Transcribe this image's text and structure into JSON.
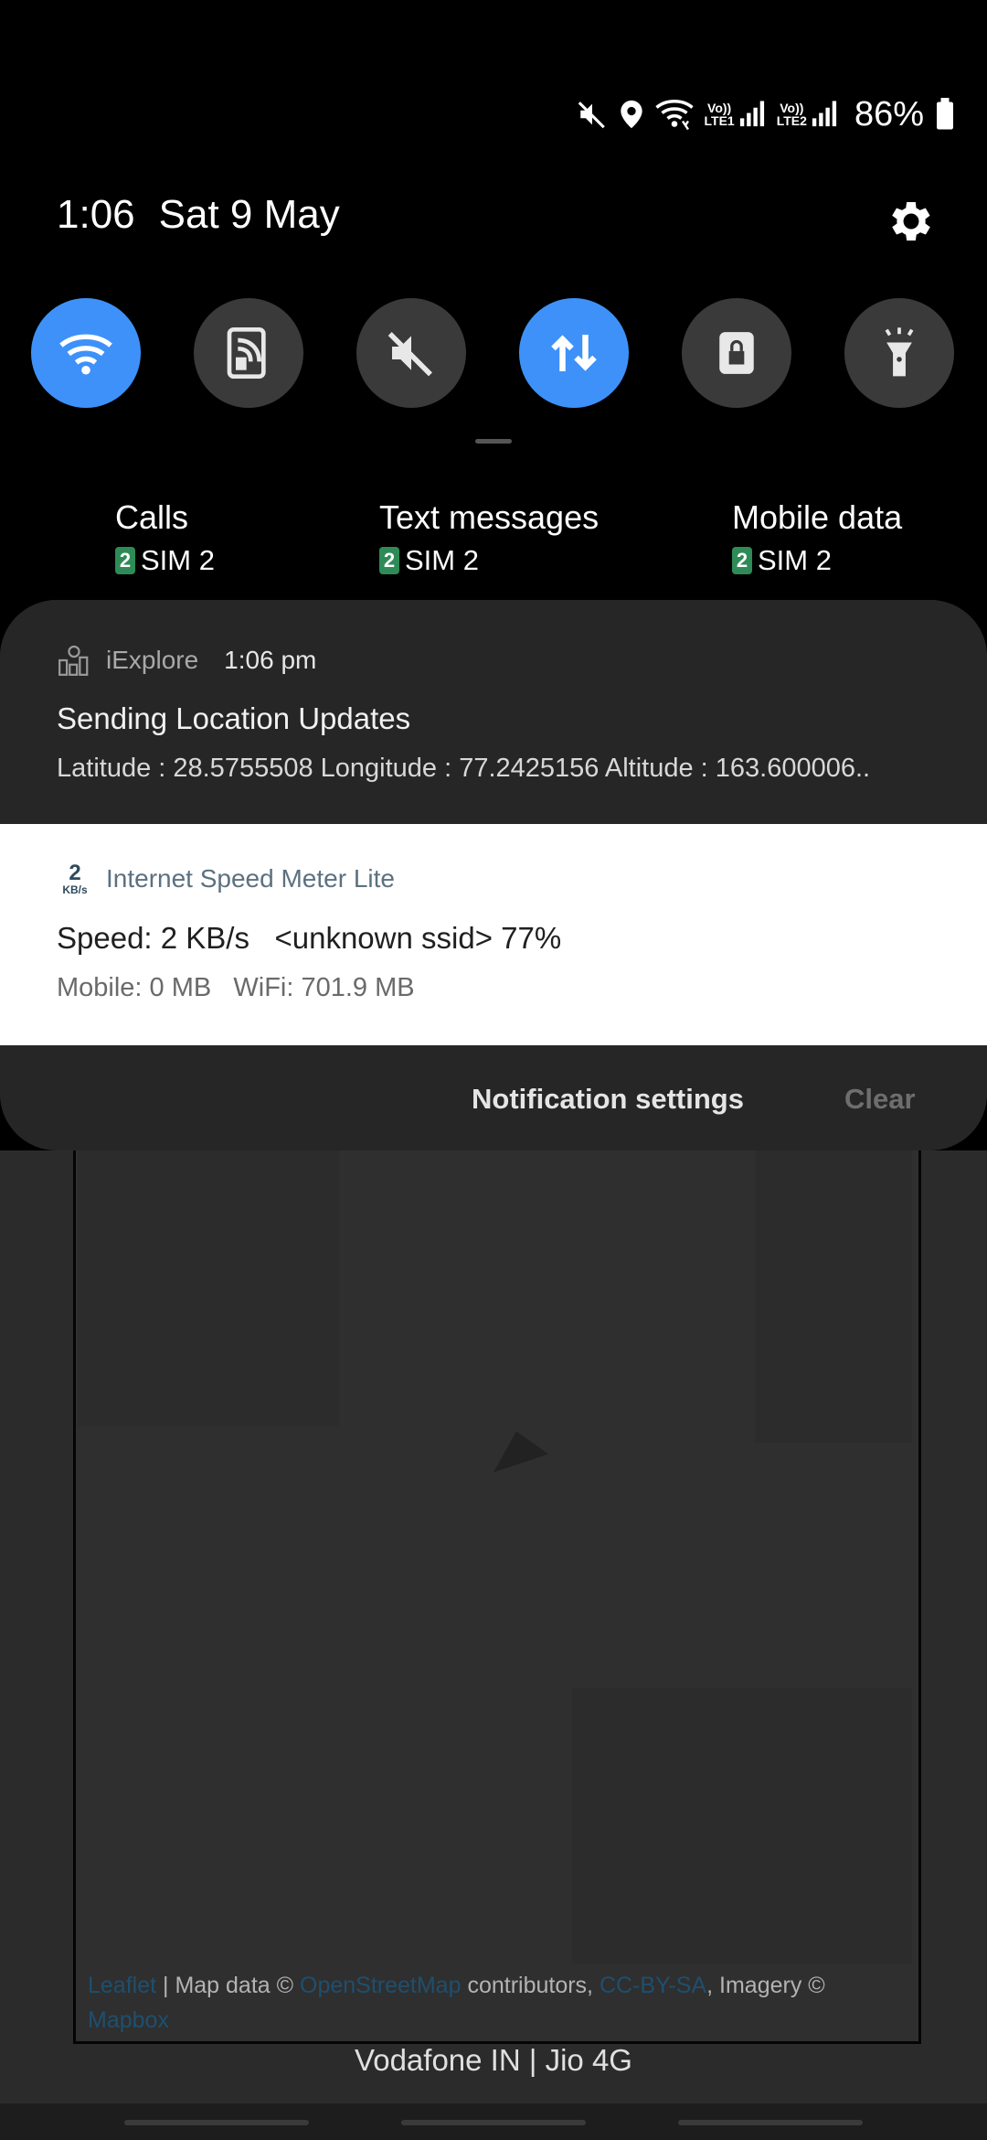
{
  "status_bar": {
    "icons": [
      "mute-icon",
      "location-icon",
      "wifi-icon",
      "volte-sim1-signal-icon",
      "volte-sim2-signal-icon",
      "battery-icon"
    ],
    "lte1_label": "LTE1",
    "lte2_label": "LTE2",
    "vo_label": "Vo))",
    "battery": "86%"
  },
  "header": {
    "time": "1:06",
    "date": "Sat 9 May"
  },
  "quick_toggles": [
    {
      "name": "wifi",
      "state": "on"
    },
    {
      "name": "nfc",
      "state": "off"
    },
    {
      "name": "sound",
      "state": "off"
    },
    {
      "name": "mobile-data",
      "state": "on"
    },
    {
      "name": "secure-folder",
      "state": "off"
    },
    {
      "name": "flashlight",
      "state": "off"
    }
  ],
  "sim_settings": [
    {
      "title": "Calls",
      "sim_number": "2",
      "sim": "SIM 2"
    },
    {
      "title": "Text messages",
      "sim_number": "2",
      "sim": "SIM 2"
    },
    {
      "title": "Mobile data",
      "sim_number": "2",
      "sim": "SIM 2"
    }
  ],
  "notifications": [
    {
      "app": "iExplore",
      "time": "1:06 pm",
      "title": "Sending Location Updates",
      "text": "Latitude : 28.5755508 Longitude : 77.2425156 Altitude : 163.600006.."
    },
    {
      "app": "Internet Speed Meter Lite",
      "icon_value": "2",
      "icon_unit": "KB/s",
      "title": "Speed: 2 KB/s   <unknown ssid> 77%",
      "text": "Mobile: 0 MB   WiFi: 701.9 MB"
    }
  ],
  "footer": {
    "notification_settings": "Notification settings",
    "clear": "Clear"
  },
  "map": {
    "attribution_leaflet": "Leaflet",
    "attribution_sep1": " | Map data © ",
    "attribution_osm": "OpenStreetMap",
    "attribution_sep2": " contributors, ",
    "attribution_license": "CC-BY-SA",
    "attribution_sep3": ", Imagery © ",
    "attribution_mapbox": "Mapbox"
  },
  "carrier": "Vodafone IN | Jio 4G"
}
